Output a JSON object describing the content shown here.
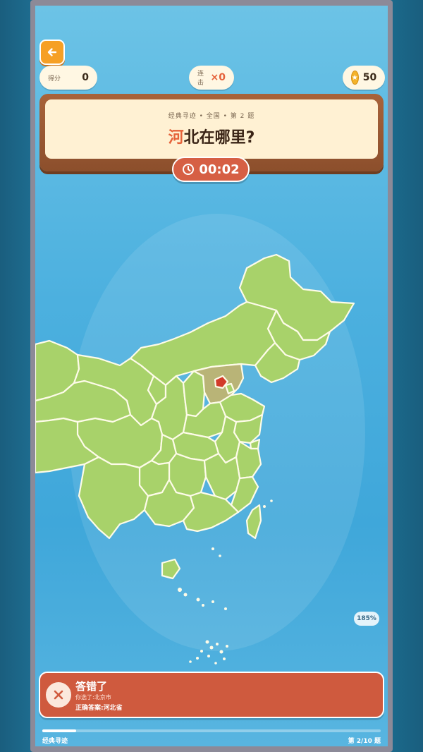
{
  "header": {
    "score_label": "得分",
    "score_value": "0",
    "combo_label": "连击",
    "combo_value": "×0",
    "coins": "50"
  },
  "question": {
    "subtitle": "经典寻迹 • 全国 • 第 2 题",
    "highlight": "河",
    "rest": "北在哪里?"
  },
  "timer": {
    "time": "00:02"
  },
  "map": {
    "zoom_label": "185%",
    "province_color": "#a8d26a",
    "highlight_color": "#b9b477",
    "wrong_pick_color": "#d23b2a"
  },
  "result": {
    "title": "答错了",
    "picked": "你选了:北京市",
    "answer": "正确答案:河北省"
  },
  "footer": {
    "mode": "经典寻迹",
    "progress_text": "第 2/10 题",
    "progress_fraction": 0.1
  },
  "colors": {
    "accent": "#f6a025",
    "error": "#cf5a3e",
    "highlight_text": "#e5623a"
  }
}
